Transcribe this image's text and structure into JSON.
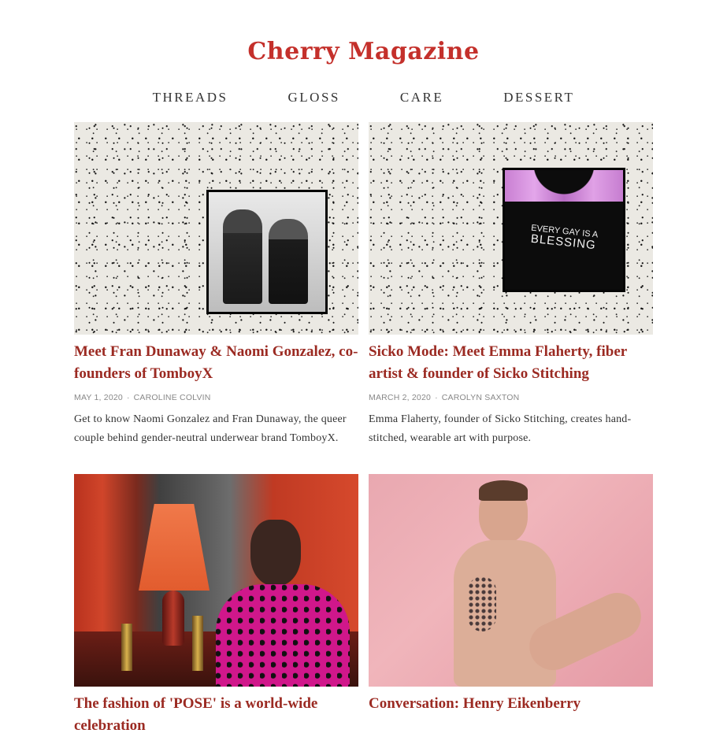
{
  "brand": {
    "name": "Cherry Magazine"
  },
  "nav": {
    "items": [
      "THREADS",
      "GLOSS",
      "CARE",
      "DESSERT"
    ]
  },
  "articles": [
    {
      "title": "Meet Fran Dunaway & Naomi Gonzalez, co-founders of TomboyX",
      "date": "MAY 1, 2020",
      "author": "CAROLINE COLVIN",
      "excerpt": "Get to know Naomi Gonzalez and Fran Dunaway, the queer couple behind gender-neutral underwear brand TomboyX."
    },
    {
      "title": "Sicko Mode: Meet Emma Flaherty, fiber artist & founder of Sicko Stitching",
      "date": "MARCH 2, 2020",
      "author": "CAROLYN SAXTON",
      "excerpt": "Emma Flaherty, founder of Sicko Stitching, creates hand-stitched, wearable art with purpose.",
      "shirt_text_line1": "EVERY GAY IS A",
      "shirt_text_line2": "BLESSING"
    },
    {
      "title": "The fashion of 'POSE' is a world-wide celebration",
      "date": "",
      "author": "",
      "excerpt": ""
    },
    {
      "title": "Conversation: Henry Eikenberry",
      "date": "",
      "author": "",
      "excerpt": ""
    }
  ],
  "colors": {
    "brand_red": "#c4302b",
    "headline_red": "#9b2a22"
  }
}
